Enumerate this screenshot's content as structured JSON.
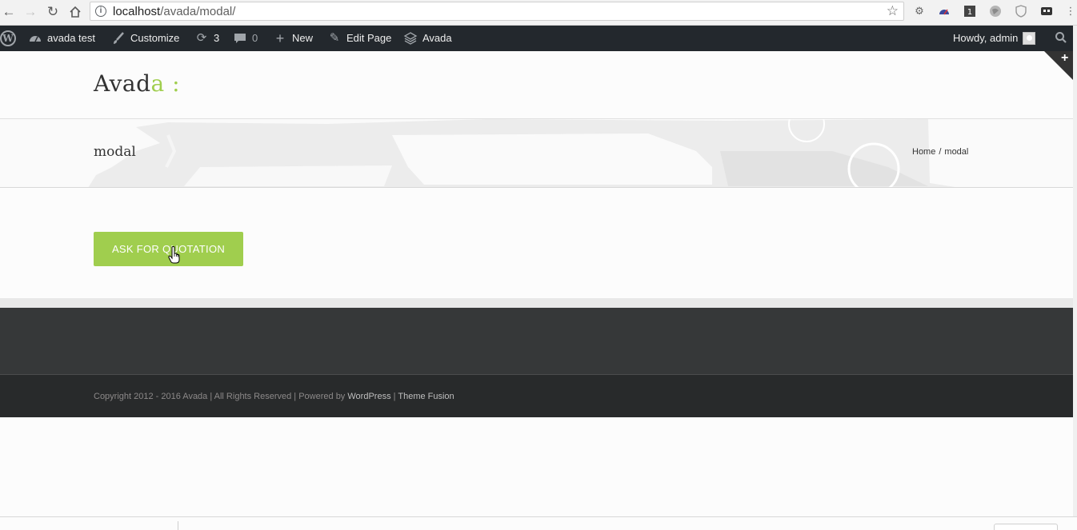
{
  "browser": {
    "url_host": "localhost",
    "url_path": "/avada/modal/"
  },
  "adminbar": {
    "site_name": "avada test",
    "customize": "Customize",
    "updates_count": "3",
    "comments_count": "0",
    "new": "New",
    "edit_page": "Edit Page",
    "avada": "Avada",
    "howdy": "Howdy, admin"
  },
  "header": {
    "logo_main": "Avad",
    "logo_accent": "a :"
  },
  "titlebar": {
    "title": "modal",
    "breadcrumb_home": "Home",
    "breadcrumb_sep": "/",
    "breadcrumb_current": "modal"
  },
  "content": {
    "button_label": "ASK FOR QUOTATION"
  },
  "footer": {
    "copyright_prefix": "Copyright 2012 - 2016 Avada | All Rights Reserved | Powered by ",
    "link_wordpress": "WordPress",
    "pipe": " | ",
    "link_themefusion": "Theme Fusion"
  },
  "colors": {
    "accent": "#a0ce4e",
    "adminbar": "#23282d",
    "footer": "#363839",
    "copyright": "#282a2b"
  }
}
